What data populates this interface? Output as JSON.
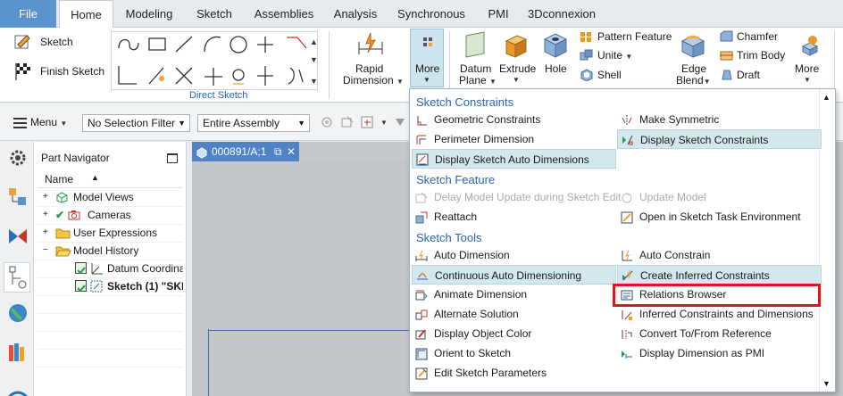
{
  "tabs": [
    "File",
    "Home",
    "Modeling",
    "Sketch",
    "Assemblies",
    "Analysis",
    "Synchronous",
    "PMI",
    "3Dconnexion"
  ],
  "ribbon": {
    "sketch": "Sketch",
    "finish_sketch": "Finish Sketch",
    "direct_sketch_label": "Direct Sketch",
    "rapid_dimension": [
      "Rapid",
      "Dimension"
    ],
    "more": "More",
    "datum_plane": [
      "Datum",
      "Plane"
    ],
    "extrude": "Extrude",
    "hole": "Hole",
    "pattern_feature": "Pattern Feature",
    "unite": "Unite",
    "shell": "Shell",
    "edge_blend": [
      "Edge",
      "Blend"
    ],
    "chamfer": "Chamfer",
    "trim_body": "Trim Body",
    "draft": "Draft",
    "more2": "More"
  },
  "cmdbar": {
    "menu": "Menu",
    "selection_filter": "No Selection Filter",
    "assembly_scope": "Entire Assembly"
  },
  "navigator": {
    "title": "Part Navigator",
    "col_name": "Name",
    "rows": [
      {
        "label": "Model Views",
        "icon": "model-views-icon"
      },
      {
        "label": "Cameras",
        "icon": "cameras-icon"
      },
      {
        "label": "User Expressions",
        "icon": "folder-icon"
      },
      {
        "label": "Model History",
        "icon": "folder-open-icon"
      },
      {
        "label": "Datum Coordina",
        "icon": "datum-csys-icon"
      },
      {
        "label": "Sketch (1) \"SKE",
        "icon": "sketch-feature-icon"
      }
    ]
  },
  "graphics": {
    "doc_tab": "000891/A;1"
  },
  "menu": {
    "sections": [
      "Sketch Constraints",
      "Sketch Feature",
      "Sketch Tools"
    ],
    "items": [
      {
        "label": "Geometric Constraints",
        "icon": "geometric-constraints-icon"
      },
      {
        "label": "Make Symmetric",
        "icon": "make-symmetric-icon"
      },
      {
        "label": "Perimeter Dimension",
        "icon": "perimeter-dimension-icon"
      },
      {
        "label": "Display Sketch Constraints",
        "icon": "display-constraints-icon"
      },
      {
        "label": "Display Sketch Auto Dimensions",
        "icon": "auto-dimensions-icon"
      },
      {
        "label": "Delay Model Update during Sketch Edit",
        "icon": "delay-update-icon"
      },
      {
        "label": "Update Model",
        "icon": "update-model-icon"
      },
      {
        "label": "Reattach",
        "icon": "reattach-icon"
      },
      {
        "label": "Open in Sketch Task Environment",
        "icon": "task-environment-icon"
      },
      {
        "label": "Auto Dimension",
        "icon": "auto-dimension-icon"
      },
      {
        "label": "Auto Constrain",
        "icon": "auto-constrain-icon"
      },
      {
        "label": "Continuous Auto Dimensioning",
        "icon": "continuous-dimensioning-icon"
      },
      {
        "label": "Create Inferred Constraints",
        "icon": "inferred-constraints-icon"
      },
      {
        "label": "Animate Dimension",
        "icon": "animate-dimension-icon"
      },
      {
        "label": "Relations Browser",
        "icon": "relations-browser-icon"
      },
      {
        "label": "Alternate Solution",
        "icon": "alternate-solution-icon"
      },
      {
        "label": "Inferred Constraints and Dimensions",
        "icon": "inferred-settings-icon"
      },
      {
        "label": "Display Object Color",
        "icon": "object-color-icon"
      },
      {
        "label": "Convert To/From Reference",
        "icon": "convert-reference-icon"
      },
      {
        "label": "Orient to Sketch",
        "icon": "orient-icon"
      },
      {
        "label": "Display Dimension as PMI",
        "icon": "dimension-pmi-icon"
      },
      {
        "label": "Edit Sketch Parameters",
        "icon": "sketch-parameters-icon"
      }
    ]
  },
  "colors": {
    "accent": "#2a64b5",
    "file_tab": "#5b93cf",
    "highlight": "#d3e7ef",
    "callout": "#e0141e"
  }
}
